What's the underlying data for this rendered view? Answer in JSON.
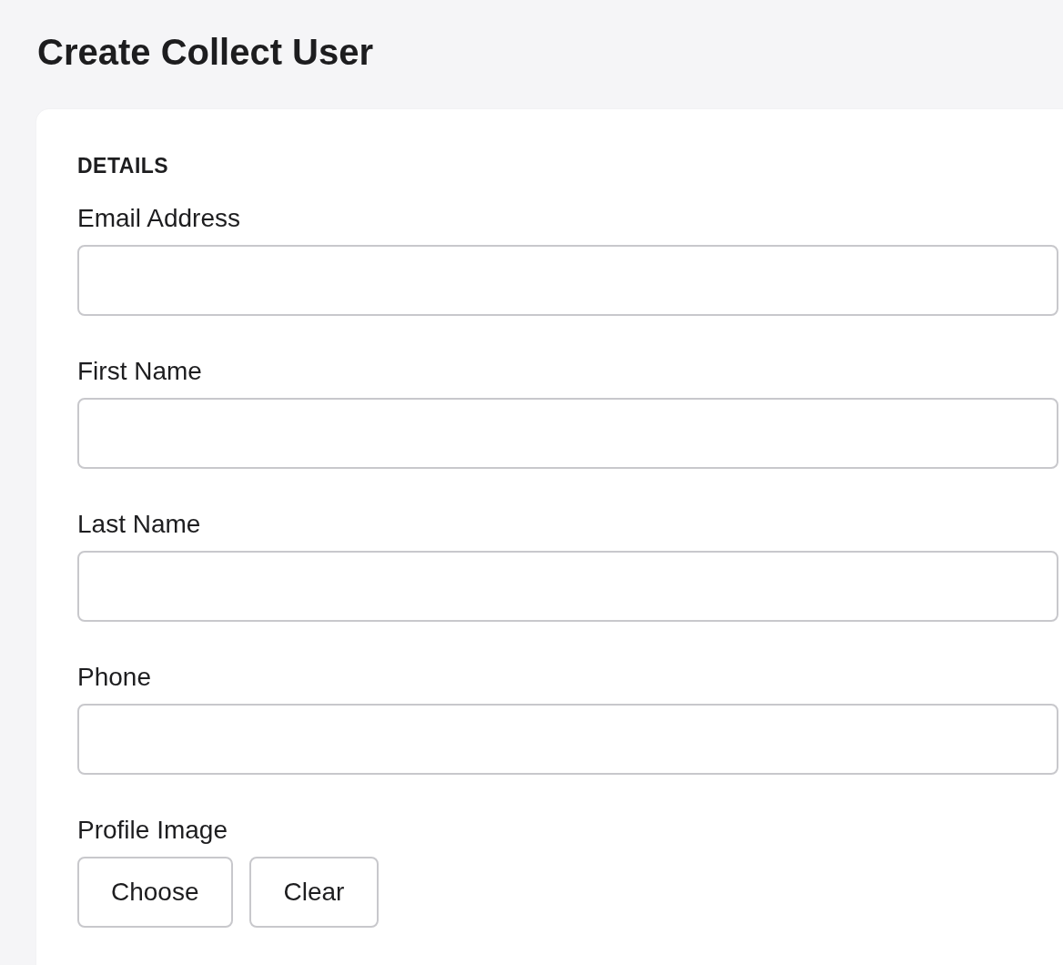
{
  "page": {
    "title": "Create Collect User"
  },
  "section": {
    "heading": "DETAILS"
  },
  "fields": [
    {
      "label": "Email Address"
    },
    {
      "label": "First Name"
    },
    {
      "label": "Last Name"
    },
    {
      "label": "Phone"
    }
  ],
  "profile_image": {
    "label": "Profile Image",
    "buttons": [
      "Choose",
      "Clear"
    ]
  }
}
